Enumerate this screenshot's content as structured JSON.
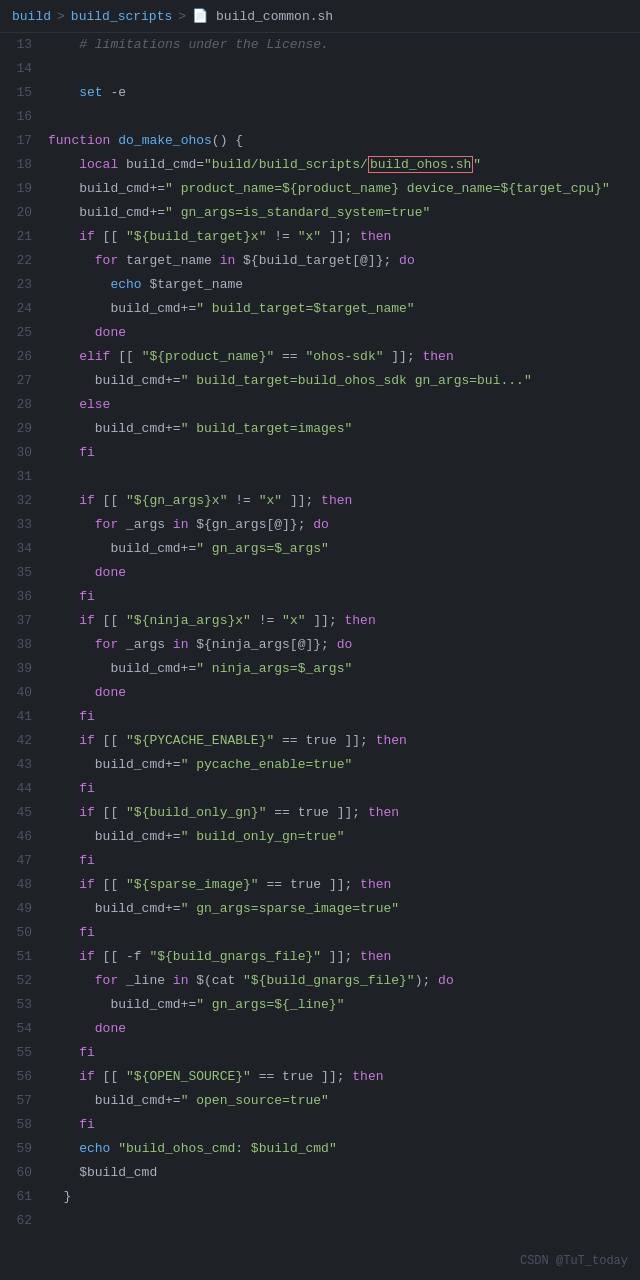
{
  "breadcrumb": {
    "part1": "build",
    "sep1": ">",
    "part2": "build_scripts",
    "sep2": ">",
    "icon": "📄",
    "current": "build_common.sh"
  },
  "watermark": "CSDN @TuT_today",
  "lines": [
    {
      "num": "13",
      "tokens": [
        {
          "t": "comment",
          "v": "    # limitations under the License."
        }
      ]
    },
    {
      "num": "14",
      "tokens": []
    },
    {
      "num": "15",
      "tokens": [
        {
          "t": "plain",
          "v": "    "
        },
        {
          "t": "cmd",
          "v": "set"
        },
        {
          "t": "plain",
          "v": " -e"
        }
      ]
    },
    {
      "num": "16",
      "tokens": []
    },
    {
      "num": "17",
      "tokens": [
        {
          "t": "kw",
          "v": "function"
        },
        {
          "t": "plain",
          "v": " "
        },
        {
          "t": "cmd",
          "v": "do_make_ohos"
        },
        {
          "t": "plain",
          "v": "() {"
        }
      ]
    },
    {
      "num": "18",
      "tokens": [
        {
          "t": "plain",
          "v": "    "
        },
        {
          "t": "kw",
          "v": "local"
        },
        {
          "t": "plain",
          "v": " build_cmd="
        },
        {
          "t": "str",
          "v": "\"build/build_scripts/"
        },
        {
          "t": "highlight",
          "v": "build_ohos.sh"
        },
        {
          "t": "str",
          "v": "\""
        }
      ]
    },
    {
      "num": "19",
      "tokens": [
        {
          "t": "plain",
          "v": "    build_cmd+="
        },
        {
          "t": "str",
          "v": "\" product_name=${product_name} device_name=${target_cpu}\""
        }
      ]
    },
    {
      "num": "20",
      "tokens": [
        {
          "t": "plain",
          "v": "    build_cmd+="
        },
        {
          "t": "str",
          "v": "\" gn_args=is_standard_system=true\""
        }
      ]
    },
    {
      "num": "21",
      "tokens": [
        {
          "t": "kw",
          "v": "    if"
        },
        {
          "t": "plain",
          "v": " [[ "
        },
        {
          "t": "str",
          "v": "\"${build_target}x\""
        },
        {
          "t": "plain",
          "v": " != "
        },
        {
          "t": "str",
          "v": "\"x\""
        },
        {
          "t": "plain",
          "v": " ]]; "
        },
        {
          "t": "kw",
          "v": "then"
        }
      ]
    },
    {
      "num": "22",
      "tokens": [
        {
          "t": "kw",
          "v": "      for"
        },
        {
          "t": "plain",
          "v": " target_name "
        },
        {
          "t": "kw",
          "v": "in"
        },
        {
          "t": "plain",
          "v": " ${build_target[@]}; "
        },
        {
          "t": "kw",
          "v": "do"
        }
      ]
    },
    {
      "num": "23",
      "tokens": [
        {
          "t": "plain",
          "v": "        "
        },
        {
          "t": "cmd",
          "v": "echo"
        },
        {
          "t": "plain",
          "v": " $target_name"
        }
      ]
    },
    {
      "num": "24",
      "tokens": [
        {
          "t": "plain",
          "v": "        build_cmd+="
        },
        {
          "t": "str",
          "v": "\" build_target=$target_name\""
        }
      ]
    },
    {
      "num": "25",
      "tokens": [
        {
          "t": "kw",
          "v": "      done"
        }
      ]
    },
    {
      "num": "26",
      "tokens": [
        {
          "t": "kw",
          "v": "    elif"
        },
        {
          "t": "plain",
          "v": " [[ "
        },
        {
          "t": "str",
          "v": "\"${product_name}\""
        },
        {
          "t": "plain",
          "v": " == "
        },
        {
          "t": "str",
          "v": "\"ohos-sdk\""
        },
        {
          "t": "plain",
          "v": " ]]; "
        },
        {
          "t": "kw",
          "v": "then"
        }
      ]
    },
    {
      "num": "27",
      "tokens": [
        {
          "t": "plain",
          "v": "      build_cmd+="
        },
        {
          "t": "str",
          "v": "\" build_target=build_ohos_sdk gn_args=bui...\""
        }
      ]
    },
    {
      "num": "28",
      "tokens": [
        {
          "t": "kw",
          "v": "    else"
        }
      ]
    },
    {
      "num": "29",
      "tokens": [
        {
          "t": "plain",
          "v": "      build_cmd+="
        },
        {
          "t": "str",
          "v": "\" build_target=images\""
        }
      ]
    },
    {
      "num": "30",
      "tokens": [
        {
          "t": "kw",
          "v": "    fi"
        }
      ]
    },
    {
      "num": "31",
      "tokens": []
    },
    {
      "num": "32",
      "tokens": [
        {
          "t": "kw",
          "v": "    if"
        },
        {
          "t": "plain",
          "v": " [[ "
        },
        {
          "t": "str",
          "v": "\"${gn_args}x\""
        },
        {
          "t": "plain",
          "v": " != "
        },
        {
          "t": "str",
          "v": "\"x\""
        },
        {
          "t": "plain",
          "v": " ]]; "
        },
        {
          "t": "kw",
          "v": "then"
        }
      ]
    },
    {
      "num": "33",
      "tokens": [
        {
          "t": "kw",
          "v": "      for"
        },
        {
          "t": "plain",
          "v": " _args "
        },
        {
          "t": "kw",
          "v": "in"
        },
        {
          "t": "plain",
          "v": " ${gn_args[@]}; "
        },
        {
          "t": "kw",
          "v": "do"
        }
      ]
    },
    {
      "num": "34",
      "tokens": [
        {
          "t": "plain",
          "v": "        build_cmd+="
        },
        {
          "t": "str",
          "v": "\" gn_args=$_args\""
        }
      ]
    },
    {
      "num": "35",
      "tokens": [
        {
          "t": "kw",
          "v": "      done"
        }
      ]
    },
    {
      "num": "36",
      "tokens": [
        {
          "t": "kw",
          "v": "    fi"
        }
      ]
    },
    {
      "num": "37",
      "tokens": [
        {
          "t": "kw",
          "v": "    if"
        },
        {
          "t": "plain",
          "v": " [[ "
        },
        {
          "t": "str",
          "v": "\"${ninja_args}x\""
        },
        {
          "t": "plain",
          "v": " != "
        },
        {
          "t": "str",
          "v": "\"x\""
        },
        {
          "t": "plain",
          "v": " ]]; "
        },
        {
          "t": "kw",
          "v": "then"
        }
      ]
    },
    {
      "num": "38",
      "tokens": [
        {
          "t": "kw",
          "v": "      for"
        },
        {
          "t": "plain",
          "v": " _args "
        },
        {
          "t": "kw",
          "v": "in"
        },
        {
          "t": "plain",
          "v": " ${ninja_args[@]}; "
        },
        {
          "t": "kw",
          "v": "do"
        }
      ]
    },
    {
      "num": "39",
      "tokens": [
        {
          "t": "plain",
          "v": "        build_cmd+="
        },
        {
          "t": "str",
          "v": "\" ninja_args=$_args\""
        }
      ]
    },
    {
      "num": "40",
      "tokens": [
        {
          "t": "kw",
          "v": "      done"
        }
      ]
    },
    {
      "num": "41",
      "tokens": [
        {
          "t": "kw",
          "v": "    fi"
        }
      ]
    },
    {
      "num": "42",
      "tokens": [
        {
          "t": "kw",
          "v": "    if"
        },
        {
          "t": "plain",
          "v": " [[ "
        },
        {
          "t": "str",
          "v": "\"${PYCACHE_ENABLE}\""
        },
        {
          "t": "plain",
          "v": " == "
        },
        {
          "t": "plain",
          "v": "true"
        },
        {
          "t": "plain",
          "v": " ]]; "
        },
        {
          "t": "kw",
          "v": "then"
        }
      ]
    },
    {
      "num": "43",
      "tokens": [
        {
          "t": "plain",
          "v": "      build_cmd+="
        },
        {
          "t": "str",
          "v": "\" pycache_enable=true\""
        }
      ]
    },
    {
      "num": "44",
      "tokens": [
        {
          "t": "kw",
          "v": "    fi"
        }
      ]
    },
    {
      "num": "45",
      "tokens": [
        {
          "t": "kw",
          "v": "    if"
        },
        {
          "t": "plain",
          "v": " [[ "
        },
        {
          "t": "str",
          "v": "\"${build_only_gn}\""
        },
        {
          "t": "plain",
          "v": " == "
        },
        {
          "t": "plain",
          "v": "true"
        },
        {
          "t": "plain",
          "v": " ]]; "
        },
        {
          "t": "kw",
          "v": "then"
        }
      ]
    },
    {
      "num": "46",
      "tokens": [
        {
          "t": "plain",
          "v": "      build_cmd+="
        },
        {
          "t": "str",
          "v": "\" build_only_gn=true\""
        }
      ]
    },
    {
      "num": "47",
      "tokens": [
        {
          "t": "kw",
          "v": "    fi"
        }
      ]
    },
    {
      "num": "48",
      "tokens": [
        {
          "t": "kw",
          "v": "    if"
        },
        {
          "t": "plain",
          "v": " [[ "
        },
        {
          "t": "str",
          "v": "\"${sparse_image}\""
        },
        {
          "t": "plain",
          "v": " == "
        },
        {
          "t": "plain",
          "v": "true"
        },
        {
          "t": "plain",
          "v": " ]]; "
        },
        {
          "t": "kw",
          "v": "then"
        }
      ]
    },
    {
      "num": "49",
      "tokens": [
        {
          "t": "plain",
          "v": "      build_cmd+="
        },
        {
          "t": "str",
          "v": "\" gn_args=sparse_image=true\""
        }
      ]
    },
    {
      "num": "50",
      "tokens": [
        {
          "t": "kw",
          "v": "    fi"
        }
      ]
    },
    {
      "num": "51",
      "tokens": [
        {
          "t": "kw",
          "v": "    if"
        },
        {
          "t": "plain",
          "v": " [[ -f "
        },
        {
          "t": "str",
          "v": "\"${build_gnargs_file}\""
        },
        {
          "t": "plain",
          "v": " ]]; "
        },
        {
          "t": "kw",
          "v": "then"
        }
      ]
    },
    {
      "num": "52",
      "tokens": [
        {
          "t": "kw",
          "v": "      for"
        },
        {
          "t": "plain",
          "v": " _line "
        },
        {
          "t": "kw",
          "v": "in"
        },
        {
          "t": "plain",
          "v": " $(cat "
        },
        {
          "t": "str",
          "v": "\"${build_gnargs_file}\""
        },
        {
          "t": "plain",
          "v": "); "
        },
        {
          "t": "kw",
          "v": "do"
        }
      ]
    },
    {
      "num": "53",
      "tokens": [
        {
          "t": "plain",
          "v": "        build_cmd+="
        },
        {
          "t": "str",
          "v": "\" gn_args=${_line}\""
        }
      ]
    },
    {
      "num": "54",
      "tokens": [
        {
          "t": "kw",
          "v": "      done"
        }
      ]
    },
    {
      "num": "55",
      "tokens": [
        {
          "t": "kw",
          "v": "    fi"
        }
      ]
    },
    {
      "num": "56",
      "tokens": [
        {
          "t": "kw",
          "v": "    if"
        },
        {
          "t": "plain",
          "v": " [[ "
        },
        {
          "t": "str",
          "v": "\"${OPEN_SOURCE}\""
        },
        {
          "t": "plain",
          "v": " == "
        },
        {
          "t": "plain",
          "v": "true"
        },
        {
          "t": "plain",
          "v": " ]]; "
        },
        {
          "t": "kw",
          "v": "then"
        }
      ]
    },
    {
      "num": "57",
      "tokens": [
        {
          "t": "plain",
          "v": "      build_cmd+="
        },
        {
          "t": "str",
          "v": "\" open_source=true\""
        }
      ]
    },
    {
      "num": "58",
      "tokens": [
        {
          "t": "kw",
          "v": "    fi"
        }
      ]
    },
    {
      "num": "59",
      "tokens": [
        {
          "t": "plain",
          "v": "    "
        },
        {
          "t": "cmd",
          "v": "echo"
        },
        {
          "t": "plain",
          "v": " "
        },
        {
          "t": "str",
          "v": "\"build_ohos_cmd: $build_cmd\""
        }
      ]
    },
    {
      "num": "60",
      "tokens": [
        {
          "t": "plain",
          "v": "    $build_cmd"
        }
      ]
    },
    {
      "num": "61",
      "tokens": [
        {
          "t": "plain",
          "v": "  }"
        }
      ]
    },
    {
      "num": "62",
      "tokens": []
    }
  ]
}
